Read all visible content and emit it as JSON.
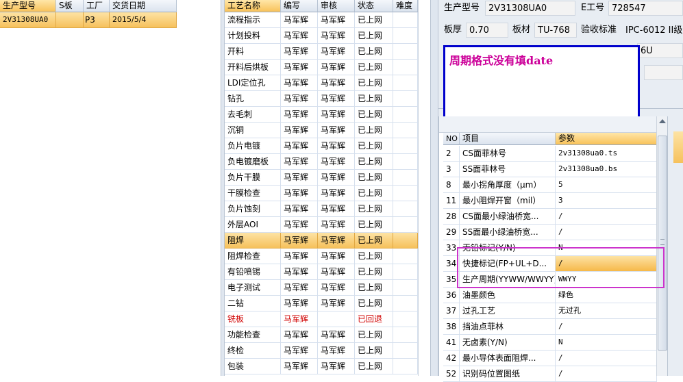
{
  "left_grid": {
    "columns": [
      "生产型号",
      "S板",
      "工厂",
      "交货日期"
    ],
    "rows": [
      {
        "model": "2V31308UA0",
        "s_board": "",
        "factory": "P3",
        "date": "2015/5/4"
      }
    ]
  },
  "process_grid": {
    "columns": [
      "工艺名称",
      "编写",
      "审核",
      "状态",
      "难度"
    ],
    "rows": [
      {
        "name": "流程指示",
        "writer": "马军辉",
        "reviewer": "马军辉",
        "status": "已上网"
      },
      {
        "name": "计划投料",
        "writer": "马军辉",
        "reviewer": "马军辉",
        "status": "已上网"
      },
      {
        "name": "开料",
        "writer": "马军辉",
        "reviewer": "马军辉",
        "status": "已上网"
      },
      {
        "name": "开料后烘板",
        "writer": "马军辉",
        "reviewer": "马军辉",
        "status": "已上网"
      },
      {
        "name": "LDI定位孔",
        "writer": "马军辉",
        "reviewer": "马军辉",
        "status": "已上网"
      },
      {
        "name": "钻孔",
        "writer": "马军辉",
        "reviewer": "马军辉",
        "status": "已上网"
      },
      {
        "name": "去毛刺",
        "writer": "马军辉",
        "reviewer": "马军辉",
        "status": "已上网"
      },
      {
        "name": "沉铜",
        "writer": "马军辉",
        "reviewer": "马军辉",
        "status": "已上网"
      },
      {
        "name": "负片电镀",
        "writer": "马军辉",
        "reviewer": "马军辉",
        "status": "已上网"
      },
      {
        "name": "负电镀磨板",
        "writer": "马军辉",
        "reviewer": "马军辉",
        "status": "已上网"
      },
      {
        "name": "负片干膜",
        "writer": "马军辉",
        "reviewer": "马军辉",
        "status": "已上网"
      },
      {
        "name": "干膜检查",
        "writer": "马军辉",
        "reviewer": "马军辉",
        "status": "已上网"
      },
      {
        "name": "负片蚀刻",
        "writer": "马军辉",
        "reviewer": "马军辉",
        "status": "已上网"
      },
      {
        "name": "外层AOI",
        "writer": "马军辉",
        "reviewer": "马军辉",
        "status": "已上网"
      },
      {
        "name": "阻焊",
        "writer": "马军辉",
        "reviewer": "马军辉",
        "status": "已上网"
      },
      {
        "name": "阻焊检查",
        "writer": "马军辉",
        "reviewer": "马军辉",
        "status": "已上网"
      },
      {
        "name": "有铅喷锡",
        "writer": "马军辉",
        "reviewer": "马军辉",
        "status": "已上网"
      },
      {
        "name": "电子测试",
        "writer": "马军辉",
        "reviewer": "马军辉",
        "status": "已上网"
      },
      {
        "name": "二钻",
        "writer": "马军辉",
        "reviewer": "马军辉",
        "status": "已上网"
      },
      {
        "name": "铣板",
        "writer": "马军辉",
        "reviewer": "",
        "status": "已回退"
      },
      {
        "name": "功能检查",
        "writer": "马军辉",
        "reviewer": "马军辉",
        "status": "已上网"
      },
      {
        "name": "终检",
        "writer": "马军辉",
        "reviewer": "马军辉",
        "status": "已上网"
      },
      {
        "name": "包装",
        "writer": "马军辉",
        "reviewer": "马军辉",
        "status": "已上网"
      }
    ]
  },
  "info_form": {
    "model_label": "生产型号",
    "model_value": "2V31308UA0",
    "eno_label": "E工号",
    "eno_value": "728547",
    "thickness_label": "板厚",
    "thickness_value": "0.70",
    "material_label": "板材",
    "material_value": "TU-768",
    "standard_label": "验收标准",
    "standard_value": "IPC-6012 II级",
    "partial_value": "6U"
  },
  "annotation": {
    "text": "周期格式没有填date",
    "text_color": "#cc0099",
    "border_color": "#0000cc",
    "highlight_color": "#cc33cc"
  },
  "param_grid": {
    "columns": [
      "NO",
      "项目",
      "参数"
    ],
    "rows": [
      {
        "no": "2",
        "item": "CS面菲林号",
        "value": "2v31308ua0.ts"
      },
      {
        "no": "3",
        "item": "SS面菲林号",
        "value": "2v31308ua0.bs"
      },
      {
        "no": "8",
        "item": "最小拐角厚度（μm）",
        "value": "5"
      },
      {
        "no": "11",
        "item": "最小阻焊开窗（mil）",
        "value": "3"
      },
      {
        "no": "28",
        "item": "CS面最小绿油桥宽...",
        "value": "/"
      },
      {
        "no": "29",
        "item": "SS面最小绿油桥宽...",
        "value": "/"
      },
      {
        "no": "33",
        "item": "无铅标记(Y/N)",
        "value": "N"
      },
      {
        "no": "34",
        "item": "快捷标记(FP+UL+D...",
        "value": "/"
      },
      {
        "no": "35",
        "item": "生产周期(YYWW/WWYY)",
        "value": "WWYY"
      },
      {
        "no": "36",
        "item": "油墨颜色",
        "value": "绿色"
      },
      {
        "no": "37",
        "item": "过孔工艺",
        "value": "无过孔"
      },
      {
        "no": "38",
        "item": "挡油点菲林",
        "value": "/"
      },
      {
        "no": "41",
        "item": "无卤素(Y/N)",
        "value": "N"
      },
      {
        "no": "42",
        "item": "最小导体表面阻焊...",
        "value": "/"
      },
      {
        "no": "52",
        "item": "识别码位置图纸",
        "value": "/"
      }
    ]
  }
}
